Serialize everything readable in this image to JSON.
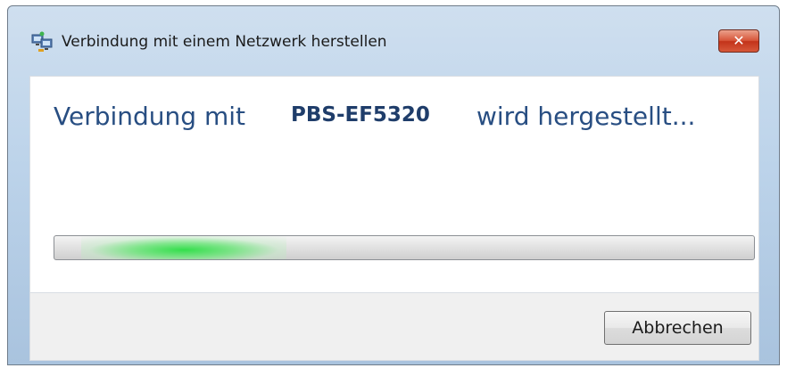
{
  "window": {
    "title": "Verbindung mit einem Netzwerk herstellen",
    "close_label": "✕"
  },
  "content": {
    "message_prefix": "Verbindung mit",
    "network_name": "PBS-EF5320",
    "message_suffix": "wird hergestellt..."
  },
  "progress": {
    "state": "indeterminate"
  },
  "buttons": {
    "cancel_label": "Abbrechen"
  },
  "colors": {
    "accent": "#1f3d6a",
    "message": "#284e82",
    "progress_glow": "#34de4c"
  },
  "icons": {
    "title_icon": "network-connection-icon",
    "close_icon": "close-icon"
  }
}
